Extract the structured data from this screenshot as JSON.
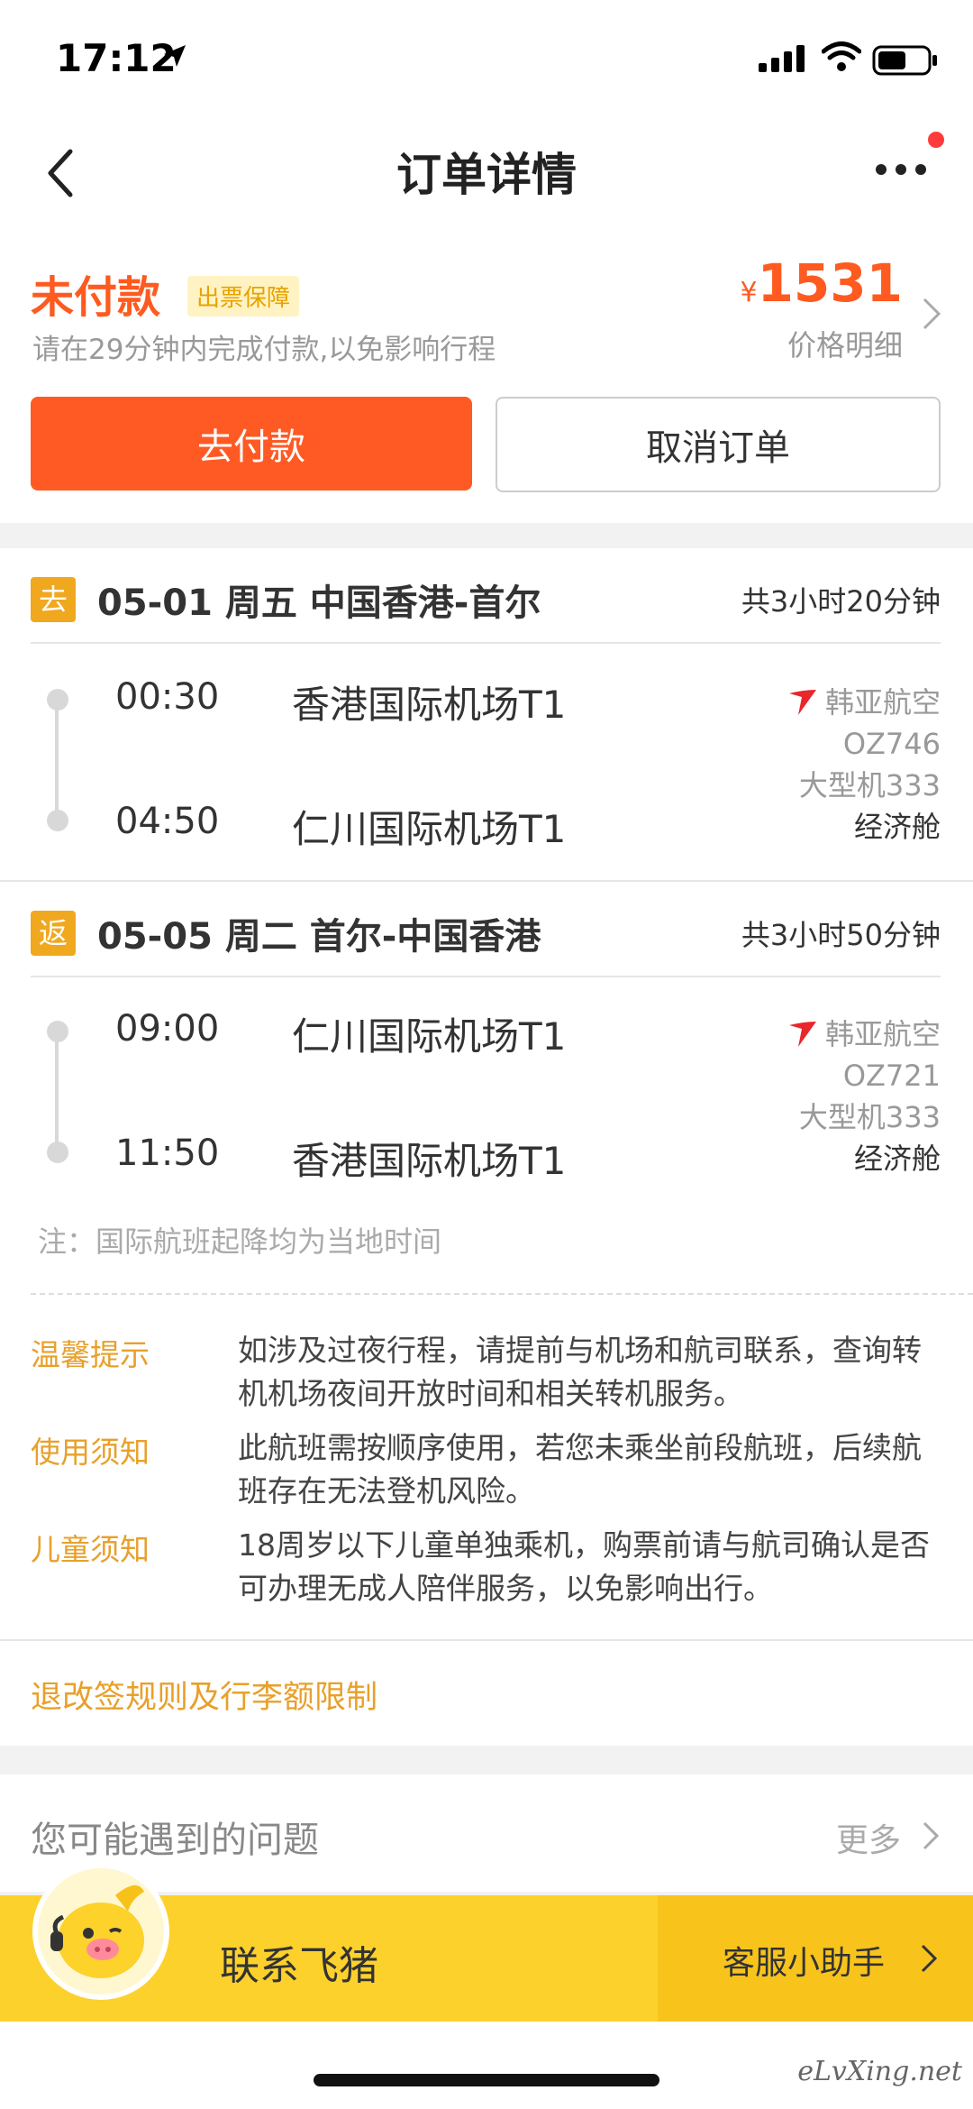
{
  "status_bar": {
    "time": "17:12"
  },
  "nav": {
    "title": "订单详情"
  },
  "payment": {
    "status": "未付款",
    "guarantee_tag": "出票保障",
    "hint": "请在29分钟内完成付款,以免影响行程",
    "currency": "¥",
    "price": "1531",
    "price_detail": "价格明细",
    "pay_button": "去付款",
    "cancel_button": "取消订单"
  },
  "segments": [
    {
      "badge": "去",
      "title": "05-01 周五 中国香港-首尔",
      "duration": "共3小时20分钟",
      "depart_time": "00:30",
      "depart_airport": "香港国际机场T1",
      "arrive_time": "04:50",
      "arrive_airport": "仁川国际机场T1",
      "airline": "韩亚航空",
      "flight_no": "OZ746",
      "aircraft": "大型机333",
      "cabin": "经济舱"
    },
    {
      "badge": "返",
      "title": "05-05 周二 首尔-中国香港",
      "duration": "共3小时50分钟",
      "depart_time": "09:00",
      "depart_airport": "仁川国际机场T1",
      "arrive_time": "11:50",
      "arrive_airport": "香港国际机场T1",
      "airline": "韩亚航空",
      "flight_no": "OZ721",
      "aircraft": "大型机333",
      "cabin": "经济舱"
    }
  ],
  "note": "注：国际航班起降均为当地时间",
  "tips": [
    {
      "label": "温馨提示",
      "text": "如涉及过夜行程，请提前与机场和航司联系，查询转机机场夜间开放时间和相关转机服务。"
    },
    {
      "label": "使用须知",
      "text": "此航班需按顺序使用，若您未乘坐前段航班，后续航班存在无法登机风险。"
    },
    {
      "label": "儿童须知",
      "text": "18周岁以下儿童单独乘机，购票前请与航司确认是否可办理无成人陪伴服务，以免影响出行。"
    }
  ],
  "rules_link": "退改签规则及行李额限制",
  "faq": {
    "title": "您可能遇到的问题",
    "more": "更多"
  },
  "contact": {
    "title": "联系飞猪",
    "assistant": "客服小助手"
  },
  "watermark": "eLvXing.net",
  "colors": {
    "accent": "#ff5a24",
    "gold": "#f0a81e",
    "airline_red": "#e8262b",
    "bar_yellow": "#fdd12b"
  }
}
